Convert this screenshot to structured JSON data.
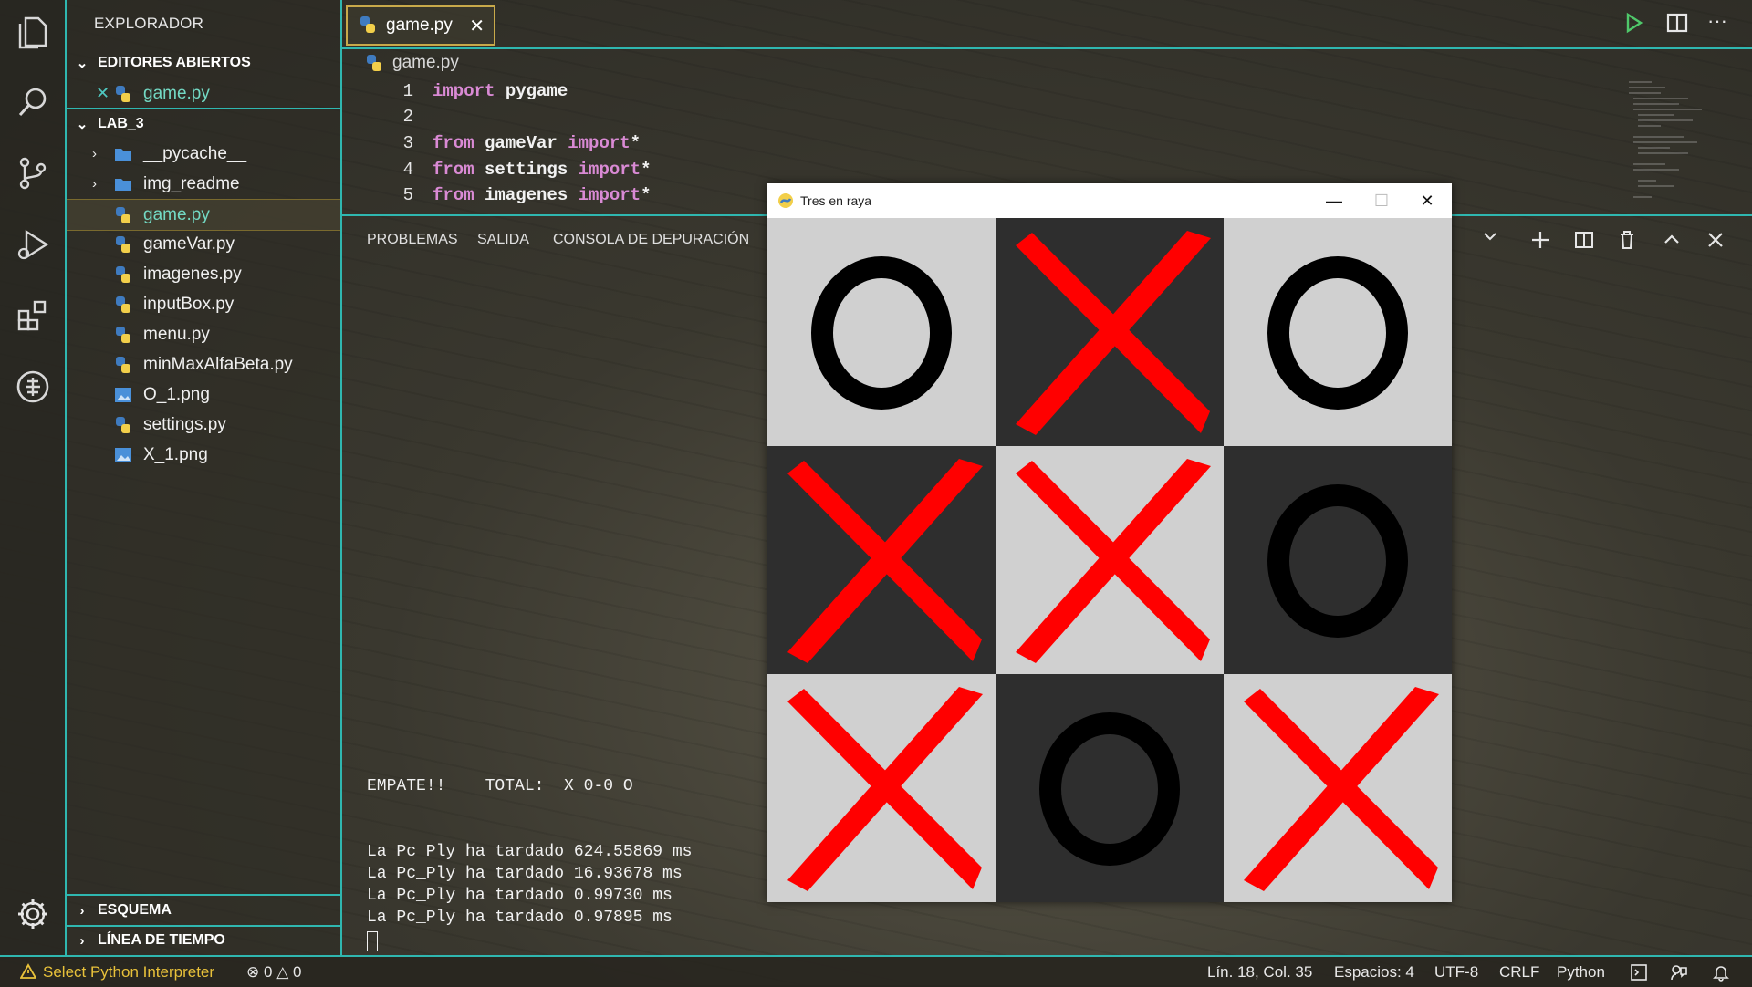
{
  "explorer": {
    "title": "EXPLORADOR",
    "open_editors": {
      "label": "EDITORES ABIERTOS",
      "files": [
        "game.py"
      ]
    },
    "project": {
      "label": "LAB_3",
      "items": [
        {
          "label": "__pycache__",
          "kind": "folder"
        },
        {
          "label": "img_readme",
          "kind": "folder"
        },
        {
          "label": "game.py",
          "kind": "python"
        },
        {
          "label": "gameVar.py",
          "kind": "python"
        },
        {
          "label": "imagenes.py",
          "kind": "python"
        },
        {
          "label": "inputBox.py",
          "kind": "python"
        },
        {
          "label": "menu.py",
          "kind": "python"
        },
        {
          "label": "minMaxAlfaBeta.py",
          "kind": "python"
        },
        {
          "label": "O_1.png",
          "kind": "image"
        },
        {
          "label": "settings.py",
          "kind": "python"
        },
        {
          "label": "X_1.png",
          "kind": "image"
        }
      ]
    },
    "outline_label": "ESQUEMA",
    "timeline_label": "LÍNEA DE TIEMPO"
  },
  "editor": {
    "tab_label": "game.py",
    "breadcrumb": "game.py",
    "lines": [
      {
        "num": "1",
        "kw1": "import",
        "id1": " pygame",
        "kw2": "",
        "tail": ""
      },
      {
        "num": "2",
        "kw1": "",
        "id1": "",
        "kw2": "",
        "tail": ""
      },
      {
        "num": "3",
        "kw1": "from",
        "id1": " gameVar ",
        "kw2": "import",
        "tail": "*"
      },
      {
        "num": "4",
        "kw1": "from",
        "id1": " settings ",
        "kw2": "import",
        "tail": "*"
      },
      {
        "num": "5",
        "kw1": "from",
        "id1": " imagenes ",
        "kw2": "import",
        "tail": "*"
      }
    ]
  },
  "panel": {
    "tabs": [
      "PROBLEMAS",
      "SALIDA",
      "CONSOLA DE DEPURACIÓN"
    ],
    "terminal": {
      "result_line": "EMPATE!!    TOTAL:  X 0-0 O",
      "timings": [
        "La Pc_Ply ha tardado 624.55869 ms",
        "La Pc_Ply ha tardado 16.93678 ms",
        "La Pc_Ply ha tardado 0.99730 ms",
        "La Pc_Ply ha tardado 0.97895 ms"
      ]
    }
  },
  "game_window": {
    "title": "Tres en raya",
    "board": [
      "O",
      "X",
      "O",
      "X",
      "X",
      "O",
      "X",
      "O",
      "X"
    ],
    "colors": {
      "light": "#d0d0d0",
      "dark": "#2e2e2e",
      "x": "#ff0000",
      "o": "#000000"
    }
  },
  "status_bar": {
    "interpreter": "Select Python Interpreter",
    "errors": "0",
    "warnings": "0",
    "position": "Lín. 18, Col. 35",
    "spaces": "Espacios: 4",
    "encoding": "UTF-8",
    "eol": "CRLF",
    "language": "Python"
  },
  "colors": {
    "accent": "#2fb7b0",
    "tab_border": "#c8a94a",
    "keyword": "#d98ad4"
  }
}
